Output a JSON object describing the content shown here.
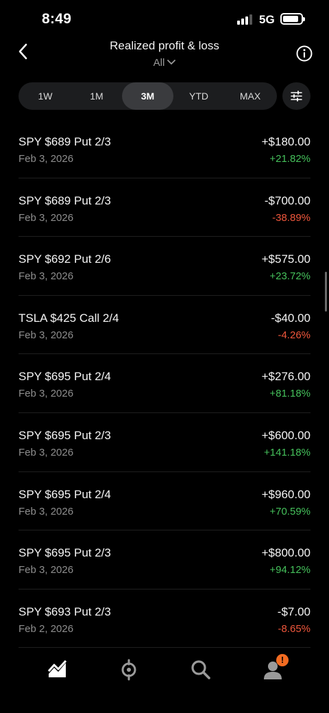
{
  "status_bar": {
    "time": "8:49",
    "network": "5G"
  },
  "header": {
    "title": "Realized profit & loss",
    "filter_label": "All"
  },
  "range_tabs": [
    {
      "label": "1W"
    },
    {
      "label": "1M"
    },
    {
      "label": "3M",
      "active": true
    },
    {
      "label": "YTD"
    },
    {
      "label": "MAX"
    }
  ],
  "colors": {
    "positive": "#45c15b",
    "negative": "#f0573c",
    "badge": "#f26b21",
    "background": "#000000"
  },
  "trades": [
    {
      "name": "SPY $689 Put 2/3",
      "date": "Feb 3, 2026",
      "amount": "+$180.00",
      "pct": "+21.82%",
      "dir": "pos"
    },
    {
      "name": "SPY $689 Put 2/3",
      "date": "Feb 3, 2026",
      "amount": "-$700.00",
      "pct": "-38.89%",
      "dir": "neg"
    },
    {
      "name": "SPY $692 Put 2/6",
      "date": "Feb 3, 2026",
      "amount": "+$575.00",
      "pct": "+23.72%",
      "dir": "pos"
    },
    {
      "name": "TSLA $425 Call 2/4",
      "date": "Feb 3, 2026",
      "amount": "-$40.00",
      "pct": "-4.26%",
      "dir": "neg"
    },
    {
      "name": "SPY $695 Put 2/4",
      "date": "Feb 3, 2026",
      "amount": "+$276.00",
      "pct": "+81.18%",
      "dir": "pos"
    },
    {
      "name": "SPY $695 Put 2/3",
      "date": "Feb 3, 2026",
      "amount": "+$600.00",
      "pct": "+141.18%",
      "dir": "pos"
    },
    {
      "name": "SPY $695 Put 2/4",
      "date": "Feb 3, 2026",
      "amount": "+$960.00",
      "pct": "+70.59%",
      "dir": "pos"
    },
    {
      "name": "SPY $695 Put 2/3",
      "date": "Feb 3, 2026",
      "amount": "+$800.00",
      "pct": "+94.12%",
      "dir": "pos"
    },
    {
      "name": "SPY $693 Put 2/3",
      "date": "Feb 2, 2026",
      "amount": "-$7.00",
      "pct": "-8.65%",
      "dir": "neg"
    }
  ],
  "tab_bar": {
    "items": [
      {
        "icon": "chart-icon"
      },
      {
        "icon": "crypto-icon"
      },
      {
        "icon": "search-icon"
      },
      {
        "icon": "account-icon"
      }
    ],
    "badge_text": "!"
  }
}
